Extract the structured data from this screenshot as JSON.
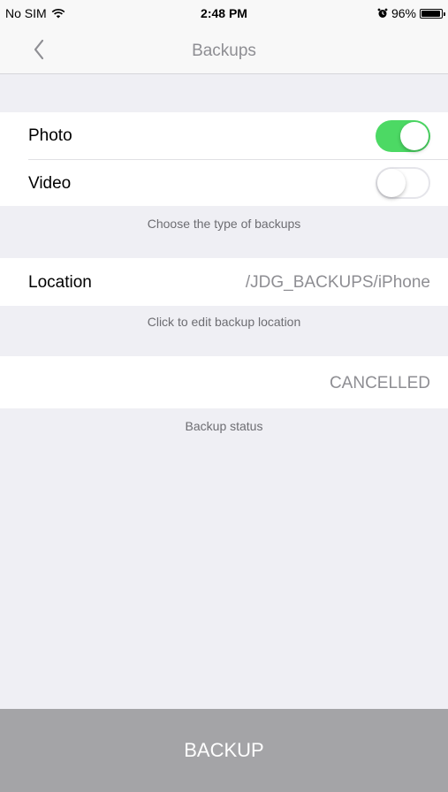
{
  "status_bar": {
    "carrier": "No SIM",
    "time": "2:48 PM",
    "battery_percent": "96%"
  },
  "nav": {
    "title": "Backups",
    "back_icon": "chevron-left-icon"
  },
  "backup_types": {
    "photo_label": "Photo",
    "photo_enabled": true,
    "video_label": "Video",
    "video_enabled": false,
    "caption": "Choose the type of backups"
  },
  "location": {
    "label": "Location",
    "value": "/JDG_BACKUPS/iPhone",
    "caption": "Click to edit backup location"
  },
  "status": {
    "value": "CANCELLED",
    "caption": "Backup status"
  },
  "backup_button": {
    "label": "BACKUP"
  },
  "colors": {
    "toggle_on": "#4cd964",
    "button_bg": "#a4a4a7",
    "background": "#efeff4"
  }
}
